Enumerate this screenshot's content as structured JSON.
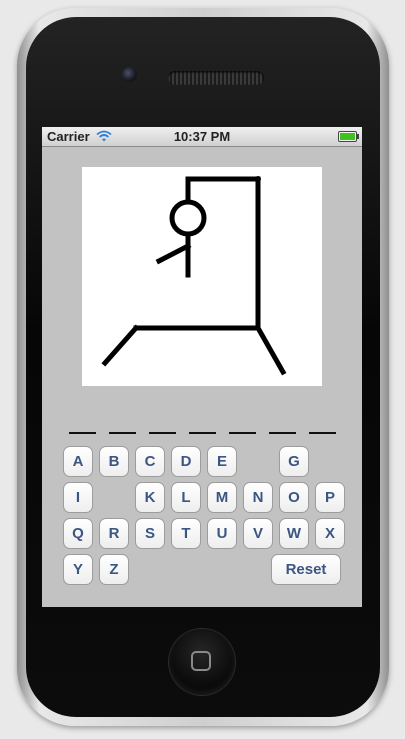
{
  "status_bar": {
    "carrier": "Carrier",
    "time": "10:37 PM",
    "wifi_icon": "wifi-icon",
    "battery_icon": "battery-full-icon",
    "battery_color": "#3ec21e"
  },
  "game": {
    "wrong_guesses_drawn": 4,
    "word_slots": 7
  },
  "keyboard": {
    "rows": [
      [
        "A",
        "B",
        "C",
        "D",
        "E",
        null,
        "G"
      ],
      [
        "I",
        null,
        "K",
        "L",
        "M",
        "N",
        "O",
        "P"
      ],
      [
        "Q",
        "R",
        "S",
        "T",
        "U",
        "V",
        "W",
        "X"
      ],
      [
        "Y",
        "Z"
      ]
    ],
    "reset_label": "Reset"
  },
  "colors": {
    "screen_background": "#c2c2c2",
    "key_text": "#3b5683",
    "drawing": "#000000"
  },
  "icons": {
    "home_button": "home-square-icon"
  }
}
